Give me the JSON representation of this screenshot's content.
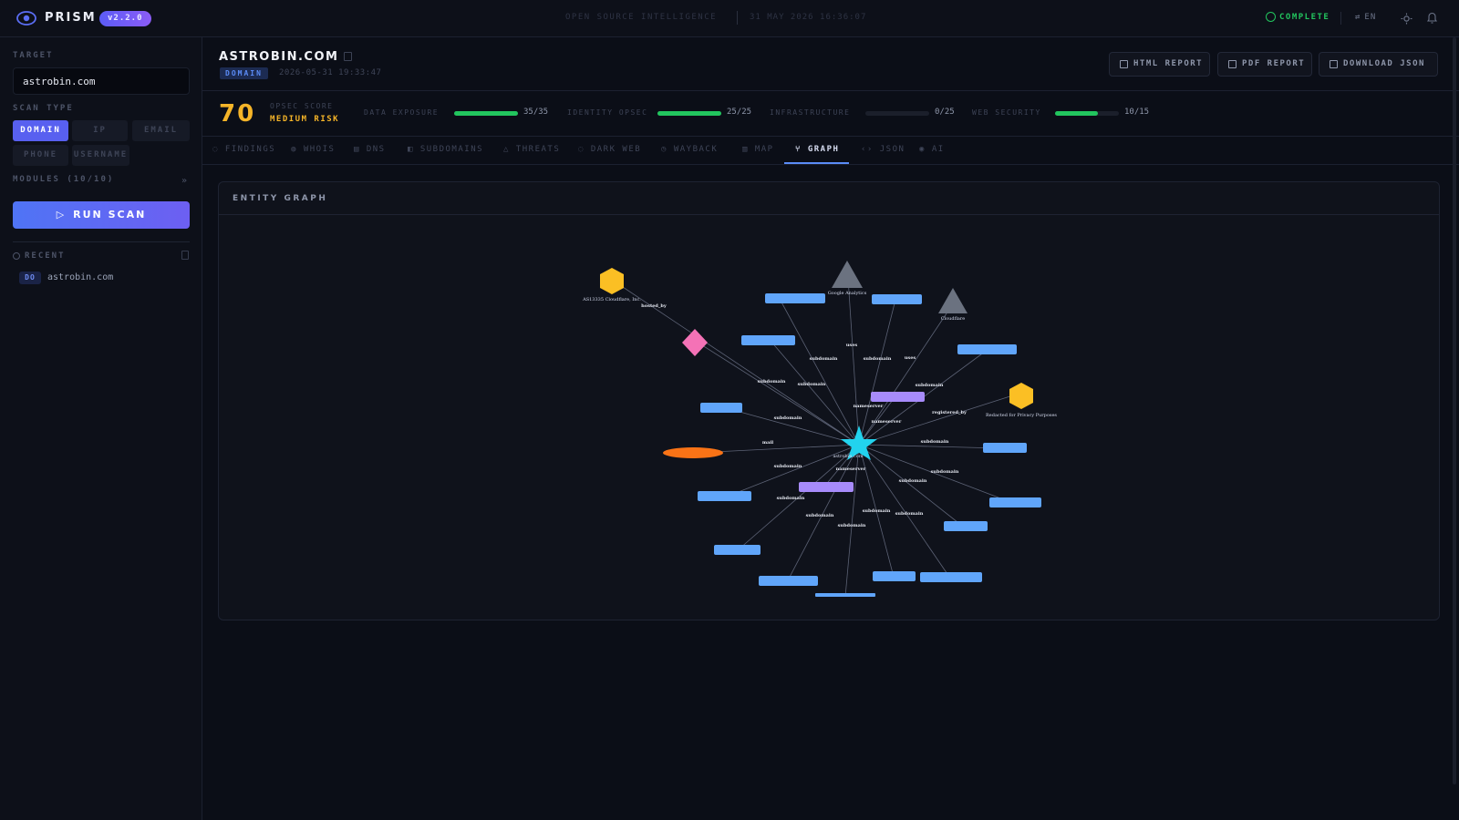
{
  "app": {
    "name": "PRISM",
    "version": "v2.2.0"
  },
  "topbar": {
    "center_title": "OPEN SOURCE INTELLIGENCE",
    "center_date": "31 MAY 2026 16:36:07",
    "status": "COMPLETE",
    "lang": "EN"
  },
  "sidebar": {
    "target_label": "TARGET",
    "target_value": "astrobin.com",
    "scan_type_label": "SCAN TYPE",
    "scan_types": [
      "DOMAIN",
      "IP",
      "EMAIL",
      "PHONE",
      "USERNAME"
    ],
    "active_scan_type": "DOMAIN",
    "modules_label": "MODULES (10/10)",
    "modules_arrow": "»",
    "run_label": "RUN SCAN",
    "recent_label": "RECENT",
    "recent_items": [
      {
        "badge": "DO",
        "name": "astrobin.com"
      }
    ]
  },
  "header": {
    "title": "ASTROBIN.COM",
    "badge": "DOMAIN",
    "date": "2026-05-31 19:33:47",
    "buttons": [
      "HTML REPORT",
      "PDF REPORT",
      "DOWNLOAD JSON"
    ]
  },
  "score": {
    "value": "70",
    "label": "OPSEC SCORE",
    "risk": "MEDIUM RISK",
    "risk_color": "#f5b428",
    "metrics": [
      {
        "label": "DATA EXPOSURE",
        "value": "35/35",
        "fraction": 1.0
      },
      {
        "label": "IDENTITY OPSEC",
        "value": "25/25",
        "fraction": 1.0
      },
      {
        "label": "INFRASTRUCTURE",
        "value": "0/25",
        "fraction": 0.0
      },
      {
        "label": "WEB SECURITY",
        "value": "10/15",
        "fraction": 0.67
      }
    ]
  },
  "tabs": [
    "FINDINGS",
    "WHOIS",
    "DNS",
    "SUBDOMAINS",
    "THREATS",
    "DARK WEB",
    "WAYBACK",
    "MAP",
    "GRAPH",
    "JSON",
    "AI"
  ],
  "active_tab": "GRAPH",
  "graph": {
    "title": "ENTITY GRAPH",
    "center_label": "astrobin.com",
    "labelled_nodes": [
      "AS13335 Cloudflare, Inc.",
      "Google Analytics",
      "Cloudflare",
      "Redacted for Privacy Purposes"
    ],
    "edge_labels": [
      "hosted_by",
      "subdomain",
      "resolves_to",
      "registered_by",
      "uses",
      "nameserver",
      "mail"
    ],
    "colors": {
      "center": "#22d3ee",
      "subdomain": "#60a5fa",
      "nameserver": "#a78bfa",
      "ip": "#f472b6",
      "org": "#fbbf24",
      "service": "#6b7280",
      "email": "#f97316"
    }
  }
}
